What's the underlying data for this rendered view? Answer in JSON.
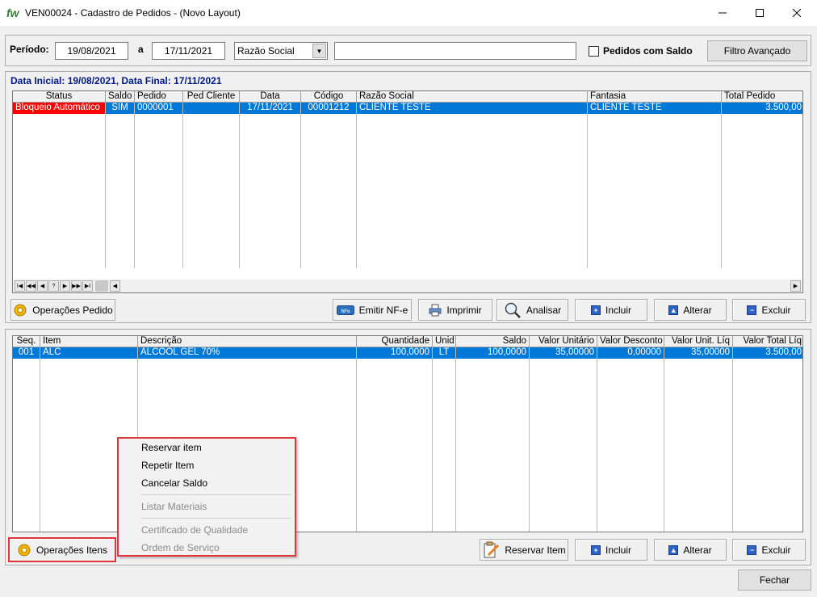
{
  "window": {
    "logo": "fw",
    "title": "VEN00024 - Cadastro de Pedidos - (Novo Layout)",
    "minimize": "—",
    "maximize": "☐",
    "close": "✕"
  },
  "filter": {
    "period_label": "Período:",
    "date_from": "19/08/2021",
    "to_label": "a",
    "date_to": "17/11/2021",
    "search_field": "Razão Social",
    "search_value": "",
    "checkbox_label": "Pedidos com Saldo",
    "advanced_button": "Filtro Avançado"
  },
  "orders": {
    "range_label": "Data Inicial: 19/08/2021, Data Final: 17/11/2021",
    "columns": [
      "Status",
      "Saldo",
      "Pedido",
      "Ped Cliente",
      "Data",
      "Código",
      "Razão Social",
      "Fantasia",
      "Total Pedido"
    ],
    "rows": [
      {
        "status": "Bloqueio Automático",
        "saldo": "SIM",
        "pedido": "0000001",
        "ped_cliente": "",
        "data": "17/11/2021",
        "codigo": "00001212",
        "razao_social": "CLIENTE TESTE",
        "fantasia": "CLIENTE TESTE",
        "total": "3.500,00"
      }
    ],
    "nav": [
      "I◀",
      "◀◀",
      "◀",
      "?",
      "▶",
      "▶▶",
      "▶I"
    ],
    "buttons": {
      "operations": "Operações Pedido",
      "emit_nfe": "Emitir NF-e",
      "print": "Imprimir",
      "analyze": "Analisar",
      "add": "Incluir",
      "edit": "Alterar",
      "delete": "Excluir"
    },
    "nfe_icon_text": "NFe"
  },
  "items": {
    "columns": [
      "Seq.",
      "Item",
      "Descrição",
      "Quantidade",
      "Unid",
      "Saldo",
      "Valor Unitário",
      "Valor Desconto",
      "Valor Unit. Líq",
      "Valor Total Líq"
    ],
    "rows": [
      {
        "seq": "001",
        "item": "ALC",
        "descricao": "ALCOOL GEL 70%",
        "quantidade": "100,0000",
        "unid": "LT",
        "saldo": "100,0000",
        "valor_unitario": "35,00000",
        "valor_desconto": "0,00000",
        "valor_unit_liq": "35,00000",
        "valor_total_liq": "3.500,00"
      }
    ],
    "buttons": {
      "operations": "Operações Itens",
      "reserve": "Reservar Item",
      "add": "Incluir",
      "edit": "Alterar",
      "delete": "Excluir"
    }
  },
  "context_menu": {
    "items": [
      {
        "label": "Reservar item",
        "enabled": true
      },
      {
        "label": "Repetir Item",
        "enabled": true
      },
      {
        "label": "Cancelar Saldo",
        "enabled": true
      },
      {
        "label": "Listar Materiais",
        "enabled": false
      },
      {
        "label": "Certificado de Qualidade",
        "enabled": false
      },
      {
        "label": "Ordem de Serviço",
        "enabled": false
      }
    ]
  },
  "footer": {
    "close_button": "Fechar"
  },
  "colors": {
    "selection": "#0078d7",
    "status_blocked": "#ff0000",
    "highlight": "#e0353a",
    "section_title": "#001a80"
  }
}
